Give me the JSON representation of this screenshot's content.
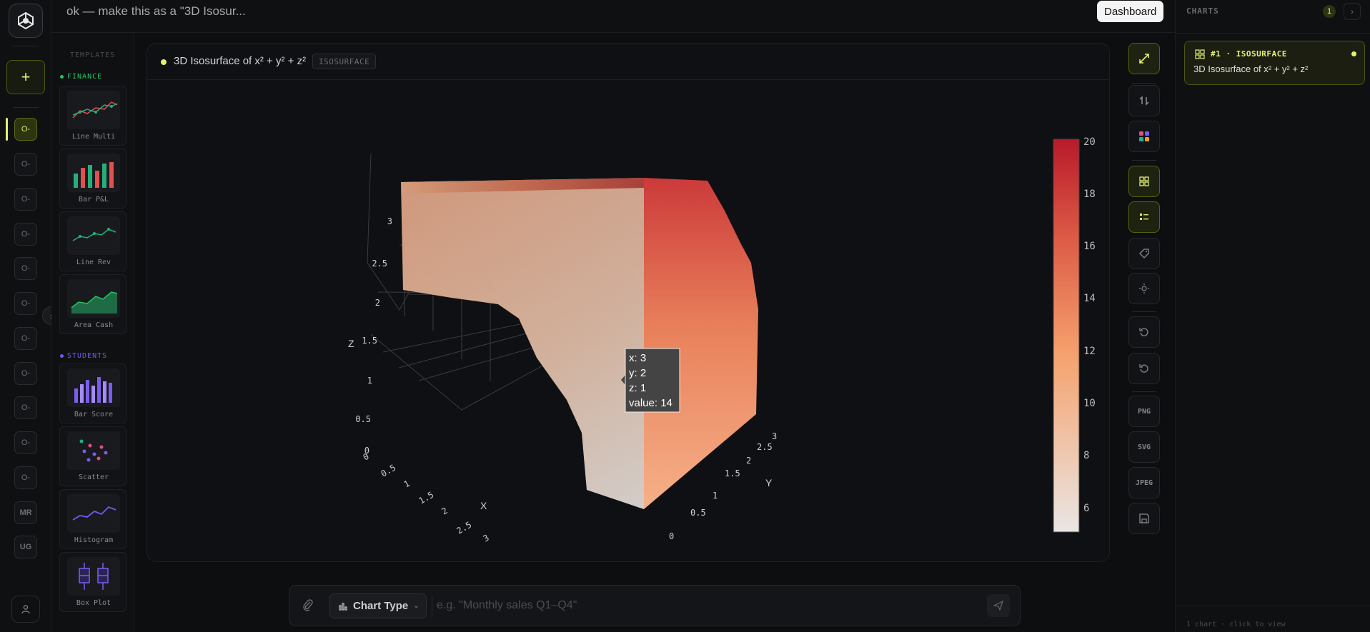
{
  "app": {
    "prompt_title": "ok — make this as a \"3D Isosur...",
    "dashboard_label": "Dashboard"
  },
  "rail": {
    "items": [
      "O-",
      "O-",
      "O-",
      "O-",
      "O-",
      "O-",
      "O-",
      "O-",
      "O-",
      "O-",
      "O-"
    ],
    "initials": [
      "MR",
      "UG"
    ]
  },
  "templates": {
    "heading": "TEMPLATES",
    "groups": [
      {
        "name": "FINANCE",
        "color": "#22c55e"
      },
      {
        "name": "STUDENTS",
        "color": "#6b5cf6"
      }
    ],
    "items": [
      {
        "label": "Line Multi",
        "icon": "line-multi-thumbnail"
      },
      {
        "label": "Bar P&L",
        "icon": "bar-pl-thumbnail"
      },
      {
        "label": "Line Rev",
        "icon": "line-rev-thumbnail"
      },
      {
        "label": "Area Cash",
        "icon": "area-cash-thumbnail"
      },
      {
        "label": "Bar Score",
        "icon": "bar-score-thumbnail"
      },
      {
        "label": "Scatter",
        "icon": "scatter-thumbnail"
      },
      {
        "label": "Histogram",
        "icon": "histogram-thumbnail"
      },
      {
        "label": "Box Plot",
        "icon": "box-plot-thumbnail"
      }
    ]
  },
  "chart_card": {
    "title": "3D Isosurface of x² + y² + z²",
    "badge": "ISOSURFACE"
  },
  "chart_data": {
    "type": "isosurface",
    "function": "x² + y² + z²",
    "x_axis": {
      "label": "X",
      "ticks": [
        "0",
        "0.5",
        "1",
        "1.5",
        "2",
        "2.5",
        "3"
      ]
    },
    "y_axis": {
      "label": "Y",
      "ticks": [
        "0",
        "0.5",
        "1",
        "1.5",
        "2",
        "2.5",
        "3"
      ]
    },
    "z_axis": {
      "label": "Z",
      "ticks": [
        "0",
        "0.5",
        "1",
        "1.5",
        "2",
        "2.5",
        "3"
      ]
    },
    "colorbar": {
      "ticks": [
        "20",
        "18",
        "16",
        "14",
        "12",
        "10",
        "8",
        "6"
      ],
      "range": [
        5,
        20
      ],
      "color_low": "#e9e6e4",
      "color_mid": "#f5a26e",
      "color_high": "#b81a2a"
    },
    "hover": {
      "x": "x: 3",
      "y": "y: 2",
      "z": "z: 1",
      "value": "value: 14"
    }
  },
  "toolbar": {
    "export": [
      "PNG",
      "SVG",
      "JPEG"
    ]
  },
  "charts_panel": {
    "title": "CHARTS",
    "count": "1",
    "card_tag": "#1 · ISOSURFACE",
    "card_title": "3D Isosurface of x² + y² + z²",
    "footer": "1 chart · click to view"
  },
  "input": {
    "chart_type_label": "Chart Type",
    "placeholder": "e.g. \"Monthly sales Q1–Q4\""
  },
  "colors": {
    "accent": "#e6f070",
    "background": "#0d0e10"
  }
}
